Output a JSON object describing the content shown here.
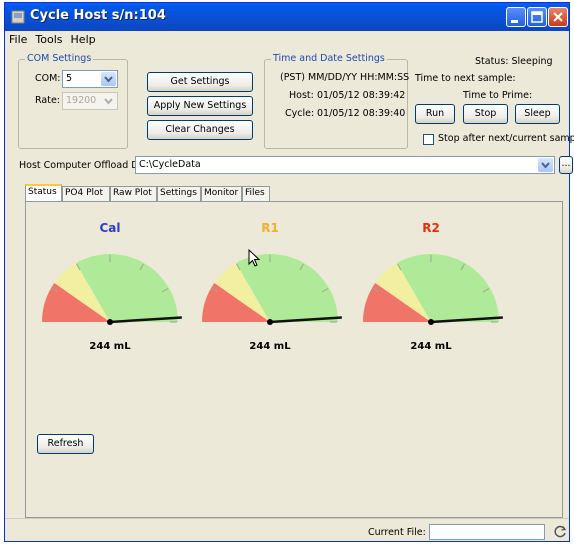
{
  "window": {
    "title": "Cycle Host s/n:104"
  },
  "menu": {
    "items": [
      "File",
      "Tools",
      "Help"
    ]
  },
  "com_settings": {
    "legend": "COM Settings",
    "com_label": "COM:",
    "com_value": "5",
    "rate_label": "Rate:",
    "rate_value": "19200"
  },
  "buttons": {
    "get_settings": "Get Settings",
    "apply_new_settings": "Apply New Settings",
    "clear_changes": "Clear Changes",
    "run": "Run",
    "stop": "Stop",
    "sleep": "Sleep",
    "browse": "...",
    "refresh": "Refresh"
  },
  "time_date": {
    "legend": "Time and Date Settings",
    "format": "(PST) MM/DD/YY HH:MM:SS",
    "host_label": "Host:",
    "host_value": "01/05/12 08:39:42",
    "cycle_label": "Cycle:",
    "cycle_value": "01/05/12 08:39:40"
  },
  "status": {
    "status_text": "Status:  Sleeping",
    "next_sample": "Time to next sample:",
    "prime": "Time to Prime:",
    "stop_after_label": "Stop after next/current sample",
    "stop_after_checked": false
  },
  "offload": {
    "label": "Host Computer Offload Dir:",
    "value": "C:\\CycleData"
  },
  "tabs": [
    "Status",
    "PO4 Plot",
    "Raw Plot",
    "Settings",
    "Monitor",
    "Files"
  ],
  "active_tab": "Status",
  "gauges": [
    {
      "label": "Cal",
      "color": "#2b3fc9",
      "value_text": "244 mL",
      "level": 0.93
    },
    {
      "label": "R1",
      "color": "#f0b030",
      "value_text": "244 mL",
      "level": 0.93
    },
    {
      "label": "R2",
      "color": "#e03010",
      "value_text": "244 mL",
      "level": 0.93
    }
  ],
  "gauge_colors": {
    "red": "#f07468",
    "yellow": "#f2f0a0",
    "green": "#aeea98"
  },
  "footer": {
    "current_file_label": "Current File:",
    "current_file_value": ""
  }
}
